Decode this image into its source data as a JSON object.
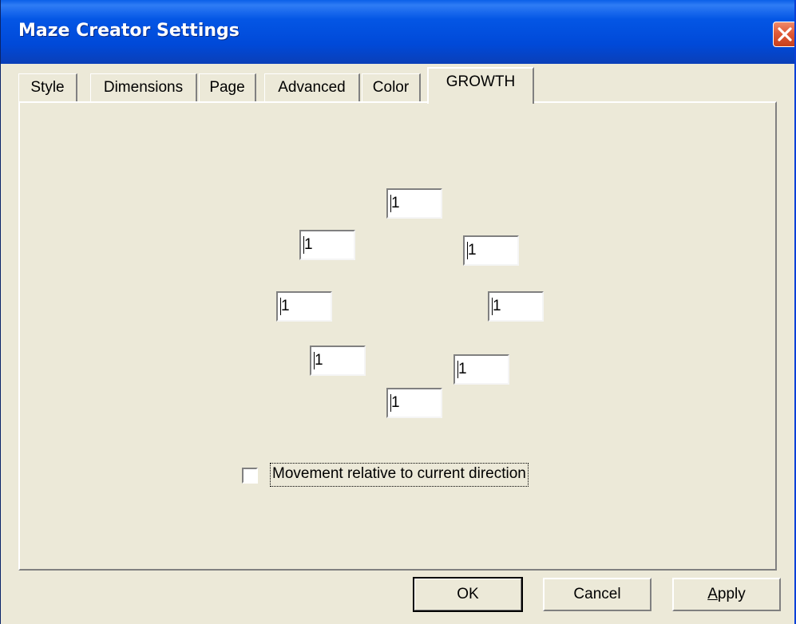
{
  "window": {
    "title": "Maze Creator Settings"
  },
  "tabs": [
    {
      "label": "Style"
    },
    {
      "label": "Dimensions"
    },
    {
      "label": "Page"
    },
    {
      "label": "Advanced"
    },
    {
      "label": "Color"
    },
    {
      "label": "GROWTH",
      "active": true
    }
  ],
  "growth": {
    "fields": {
      "top": "1",
      "upper_left": "1",
      "upper_right": "1",
      "left": "1",
      "right": "1",
      "lower_left": "1",
      "lower_right": "1",
      "bottom": "1"
    },
    "relative_movement": {
      "label": "Movement relative to current direction",
      "checked": false
    }
  },
  "buttons": {
    "ok": "OK",
    "cancel": "Cancel",
    "apply": "Apply"
  },
  "icons": {
    "close": "close-icon"
  }
}
